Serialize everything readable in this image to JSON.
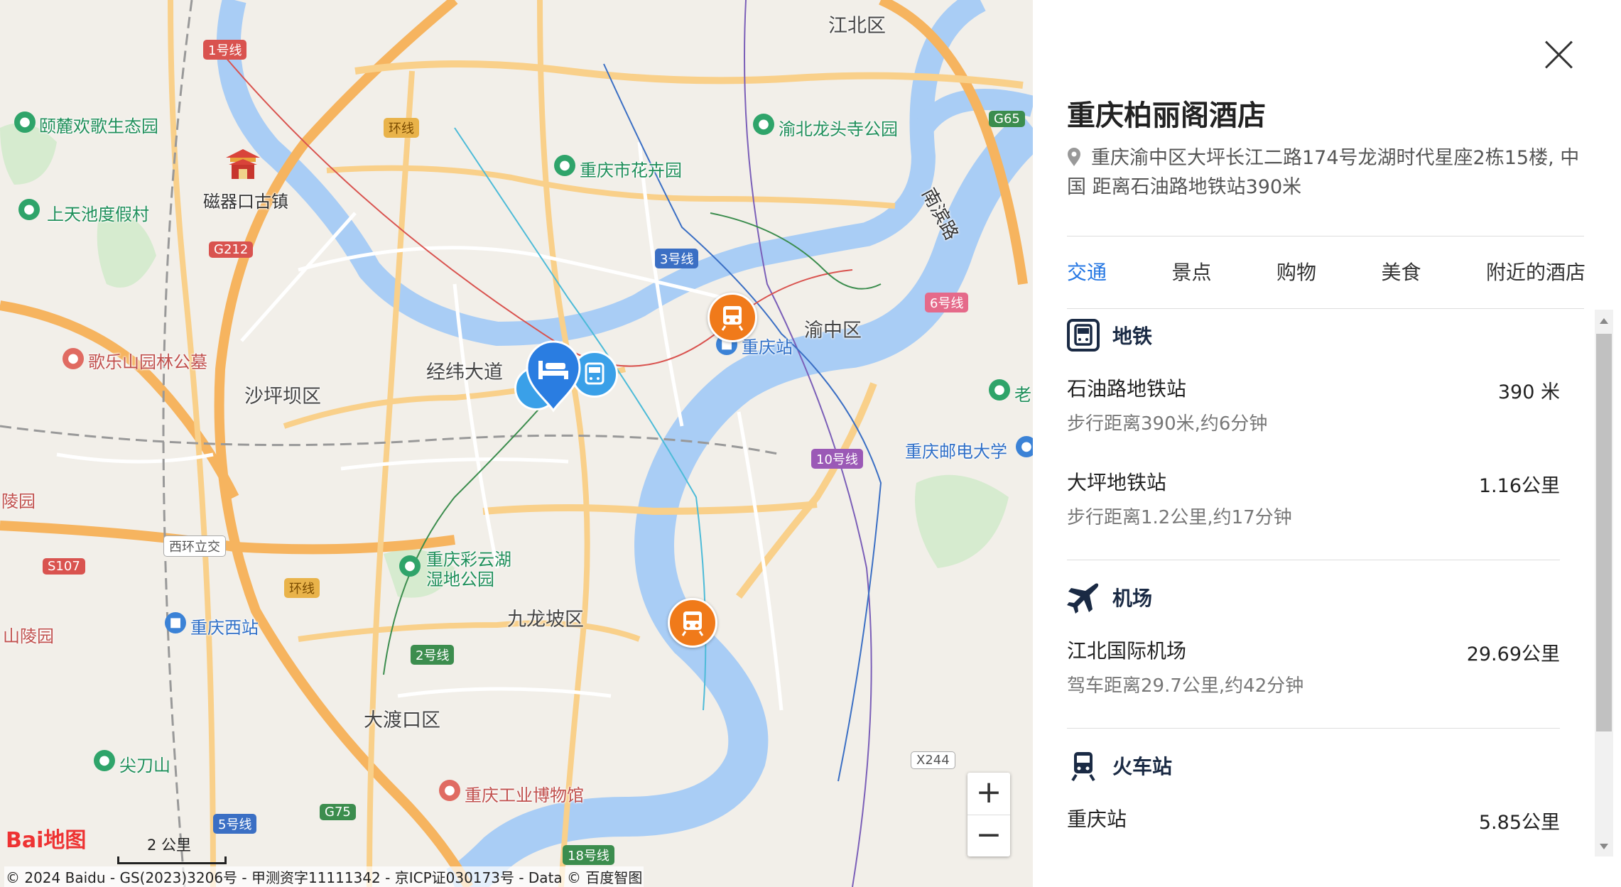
{
  "panel": {
    "hotel_name": "重庆柏丽阁酒店",
    "address": "重庆渝中区大坪长江二路174号龙湖时代星座2栋15楼, 中国 距离石油路地铁站390米",
    "tabs": [
      {
        "label": "交通",
        "active": true
      },
      {
        "label": "景点",
        "active": false
      },
      {
        "label": "购物",
        "active": false
      },
      {
        "label": "美食",
        "active": false
      },
      {
        "label": "附近的酒店",
        "active": false
      }
    ],
    "sections": [
      {
        "title": "地铁",
        "icon": "metro-icon",
        "items": [
          {
            "name": "石油路地铁站",
            "distance": "390 米",
            "desc": "步行距离390米,约6分钟"
          },
          {
            "name": "大坪地铁站",
            "distance": "1.16公里",
            "desc": "步行距离1.2公里,约17分钟"
          }
        ]
      },
      {
        "title": "机场",
        "icon": "plane-icon",
        "items": [
          {
            "name": "江北国际机场",
            "distance": "29.69公里",
            "desc": "驾车距离29.7公里,约42分钟"
          }
        ]
      },
      {
        "title": "火车站",
        "icon": "train-icon",
        "items": [
          {
            "name": "重庆站",
            "distance": "5.85公里",
            "desc": ""
          }
        ]
      }
    ],
    "accent_color": "#2577e3"
  },
  "map": {
    "districts": [
      "江北区",
      "渝中区",
      "沙坪坝区",
      "九龙坡区",
      "大渡口区"
    ],
    "road_labels": [
      "经纬大道",
      "南滨路"
    ],
    "pois": [
      "颐麓欢歌生态园",
      "磁器口古镇",
      "上天池度假村",
      "歌乐山园林公墓",
      "重庆市花卉园",
      "渝北龙头寺公园",
      "重庆站",
      "重庆邮电大学",
      "重庆彩云湖湿地公园",
      "重庆西站",
      "重庆工业博物馆",
      "尖刀山",
      "西环立交",
      "陵园",
      "山陵园",
      "老"
    ],
    "shields": [
      "1号线",
      "环线",
      "G212",
      "3号线",
      "6号线",
      "G65",
      "10号线",
      "S107",
      "环线",
      "2号线",
      "5号线",
      "G75",
      "18号线",
      "X244"
    ],
    "zoom_in": "+",
    "zoom_out": "−",
    "scale": "2 公里",
    "logo": "Bai地图",
    "copyright": "© 2024 Baidu - GS(2023)3206号 - 甲测资字11111342 - 京ICP证030173号 - Data © 百度智图"
  }
}
